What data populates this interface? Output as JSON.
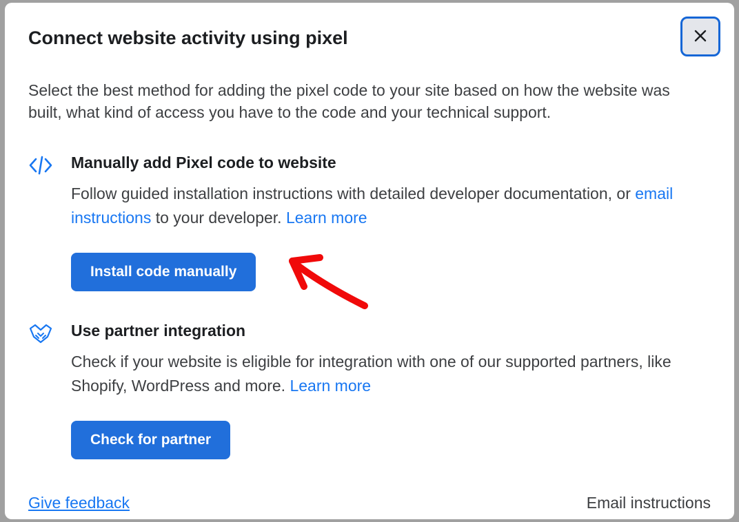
{
  "modal": {
    "title": "Connect website activity using pixel",
    "subtitle": "Select the best method for adding the pixel code to your site based on how the website was built, what kind of access you have to the code and your technical support."
  },
  "option_manual": {
    "title": "Manually add Pixel code to website",
    "desc_prefix": "Follow guided installation instructions with detailed developer documentation, or ",
    "email_link": "email instructions",
    "desc_middle": " to your developer. ",
    "learn_more": "Learn more",
    "button_label": "Install code manually"
  },
  "option_partner": {
    "title": "Use partner integration",
    "desc_prefix": "Check if your website is eligible for integration with one of our supported partners, like Shopify, WordPress and more. ",
    "learn_more": "Learn more",
    "button_label": "Check for partner"
  },
  "footer": {
    "feedback": "Give feedback",
    "email_instructions": "Email instructions"
  }
}
